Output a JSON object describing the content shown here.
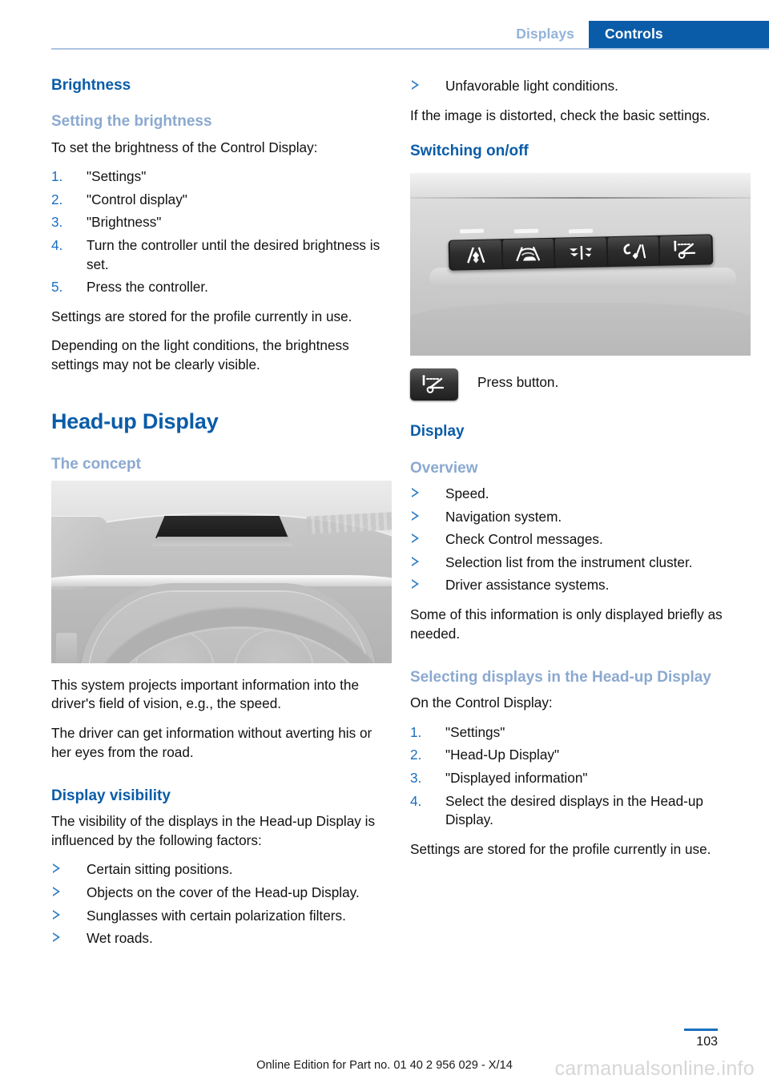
{
  "header": {
    "tab_inactive": "Displays",
    "tab_active": "Controls",
    "accent_color": "#0a5ca8",
    "inactive_color": "#93b3da",
    "rule_color": "#adc4e2"
  },
  "left_column": {
    "brightness_heading": "Brightness",
    "setting_subheading": "Setting the brightness",
    "setting_intro": "To set the brightness of the Control Display:",
    "setting_steps": [
      {
        "num": "1.",
        "text": "\"Settings\""
      },
      {
        "num": "2.",
        "text": "\"Control display\""
      },
      {
        "num": "3.",
        "text": "\"Brightness\""
      },
      {
        "num": "4.",
        "text": "Turn the controller until the desired brightness is set."
      },
      {
        "num": "5.",
        "text": "Press the controller."
      }
    ],
    "stored_note": "Settings are stored for the profile currently in use.",
    "light_note": "Depending on the light conditions, the brightness settings may not be clearly visible.",
    "headup_heading": "Head-up Display",
    "concept_subheading": "The concept",
    "concept_figure_name": "dashboard-head-up-display-illustration",
    "concept_p1": "This system projects important information into the driver's field of vision, e.g., the speed.",
    "concept_p2": "The driver can get information without averting his or her eyes from the road.",
    "visibility_subheading": "Display visibility",
    "visibility_intro": "The visibility of the displays in the Head-up Display is influenced by the following factors:",
    "visibility_items": [
      "Certain sitting positions.",
      "Objects on the cover of the Head-up Display.",
      "Sunglasses with certain polarization filters.",
      "Wet roads."
    ]
  },
  "right_column": {
    "visibility_items_cont": [
      "Unfavorable light conditions."
    ],
    "distorted_note": "If the image is distorted, check the basic settings.",
    "switching_heading": "Switching on/off",
    "switching_figure_name": "dashboard-button-panel-photo",
    "button_icons": [
      "lane-departure-warning-icon",
      "active-cruise-control-icon",
      "high-beam-assistant-icon",
      "lane-change-warning-icon",
      "head-up-display-icon"
    ],
    "press_button_icon": "head-up-display-icon",
    "press_button_label": "Press button.",
    "display_heading": "Display",
    "overview_subheading": "Overview",
    "overview_items": [
      "Speed.",
      "Navigation system.",
      "Check Control messages.",
      "Selection list from the instrument cluster.",
      "Driver assistance systems."
    ],
    "brief_note": "Some of this information is only displayed briefly as needed.",
    "selecting_subheading": "Selecting displays in the Head-up Display",
    "selecting_intro": "On the Control Display:",
    "selecting_steps": [
      {
        "num": "1.",
        "text": "\"Settings\""
      },
      {
        "num": "2.",
        "text": "\"Head-Up Display\""
      },
      {
        "num": "3.",
        "text": "\"Displayed information\""
      },
      {
        "num": "4.",
        "text": "Select the desired displays in the Head-up Display."
      }
    ],
    "stored_note": "Settings are stored for the profile currently in use."
  },
  "footer": {
    "page_number": "103",
    "edition_line": "Online Edition for Part no. 01 40 2 956 029 - X/14",
    "watermark": "carmanualsonline.info"
  }
}
